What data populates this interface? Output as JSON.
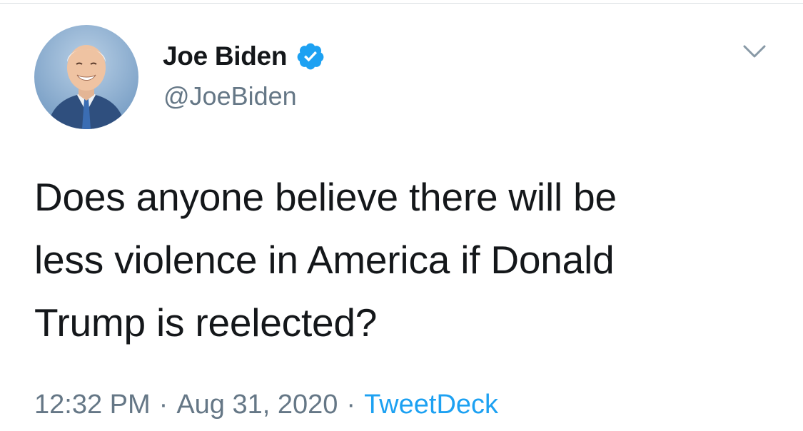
{
  "tweet": {
    "author": {
      "display_name": "Joe Biden",
      "handle": "@JoeBiden",
      "verified": true,
      "avatar_icon": "profile-photo"
    },
    "text_lines": [
      "Does anyone believe there will be",
      "less violence in America if Donald",
      "Trump is reelected?"
    ],
    "time": "12:32 PM",
    "date": "Aug 31, 2020",
    "separator": "·",
    "source": "TweetDeck"
  },
  "colors": {
    "text": "#14171a",
    "secondary": "#657786",
    "link": "#1da1f2",
    "verified_badge": "#1da1f2",
    "divider": "#d8dde1"
  },
  "icons": {
    "verified": "verified-badge-icon",
    "menu": "chevron-down-icon"
  }
}
